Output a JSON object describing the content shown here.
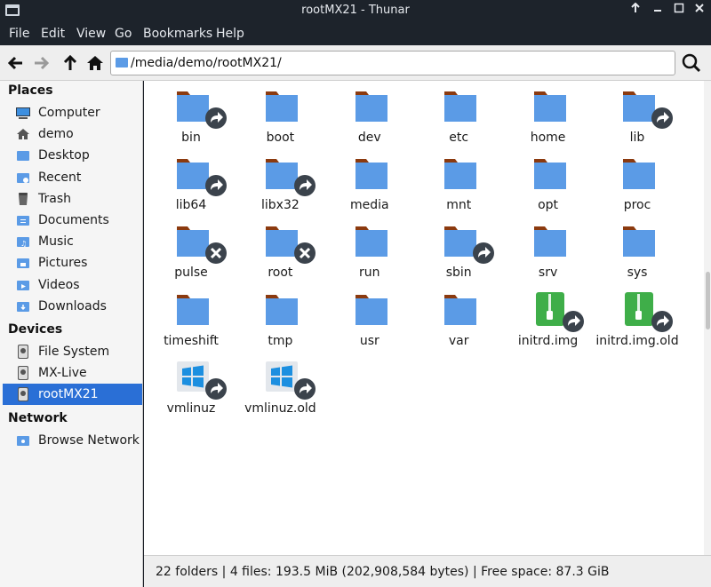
{
  "window": {
    "title": "rootMX21 - Thunar"
  },
  "menu": [
    "File",
    "Edit",
    "View",
    "Go",
    "Bookmarks",
    "Help"
  ],
  "path": "/media/demo/rootMX21/",
  "sidebar": {
    "places_title": "Places",
    "places": [
      {
        "label": "Computer",
        "icon": "computer"
      },
      {
        "label": "demo",
        "icon": "home"
      },
      {
        "label": "Desktop",
        "icon": "folder"
      },
      {
        "label": "Recent",
        "icon": "recent"
      },
      {
        "label": "Trash",
        "icon": "trash"
      },
      {
        "label": "Documents",
        "icon": "documents"
      },
      {
        "label": "Music",
        "icon": "music"
      },
      {
        "label": "Pictures",
        "icon": "pictures"
      },
      {
        "label": "Videos",
        "icon": "videos"
      },
      {
        "label": "Downloads",
        "icon": "downloads"
      }
    ],
    "devices_title": "Devices",
    "devices": [
      {
        "label": "File System",
        "icon": "drive"
      },
      {
        "label": "MX-Live",
        "icon": "drive"
      },
      {
        "label": "rootMX21",
        "icon": "drive",
        "selected": true
      }
    ],
    "network_title": "Network",
    "network": [
      {
        "label": "Browse Network",
        "icon": "network"
      }
    ]
  },
  "files": [
    {
      "name": "bin",
      "type": "folder",
      "emblem": "link"
    },
    {
      "name": "boot",
      "type": "folder",
      "emblem": ""
    },
    {
      "name": "dev",
      "type": "folder",
      "emblem": ""
    },
    {
      "name": "etc",
      "type": "folder",
      "emblem": ""
    },
    {
      "name": "home",
      "type": "folder",
      "emblem": ""
    },
    {
      "name": "lib",
      "type": "folder",
      "emblem": "link"
    },
    {
      "name": "lib64",
      "type": "folder",
      "emblem": "link"
    },
    {
      "name": "libx32",
      "type": "folder",
      "emblem": "link"
    },
    {
      "name": "media",
      "type": "folder",
      "emblem": ""
    },
    {
      "name": "mnt",
      "type": "folder",
      "emblem": ""
    },
    {
      "name": "opt",
      "type": "folder",
      "emblem": ""
    },
    {
      "name": "proc",
      "type": "folder",
      "emblem": ""
    },
    {
      "name": "pulse",
      "type": "folder",
      "emblem": "unreadable"
    },
    {
      "name": "root",
      "type": "folder",
      "emblem": "unreadable"
    },
    {
      "name": "run",
      "type": "folder",
      "emblem": ""
    },
    {
      "name": "sbin",
      "type": "folder",
      "emblem": "link"
    },
    {
      "name": "srv",
      "type": "folder",
      "emblem": ""
    },
    {
      "name": "sys",
      "type": "folder",
      "emblem": ""
    },
    {
      "name": "timeshift",
      "type": "folder",
      "emblem": ""
    },
    {
      "name": "tmp",
      "type": "folder",
      "emblem": ""
    },
    {
      "name": "usr",
      "type": "folder",
      "emblem": ""
    },
    {
      "name": "var",
      "type": "folder",
      "emblem": ""
    },
    {
      "name": "initrd.img",
      "type": "archive",
      "emblem": "link"
    },
    {
      "name": "initrd.img.old",
      "type": "archive",
      "emblem": "link"
    },
    {
      "name": "vmlinuz",
      "type": "windows",
      "emblem": "link"
    },
    {
      "name": "vmlinuz.old",
      "type": "windows",
      "emblem": "link"
    }
  ],
  "status": "22 folders  |  4 files: 193.5 MiB (202,908,584 bytes)  |  Free space: 87.3 GiB",
  "colors": {
    "folder": "#5b9be6",
    "folder_tab": "#8b3a0f",
    "archive": "#3fae49",
    "selection": "#2a6fd6",
    "emblem": "#3b434c"
  }
}
